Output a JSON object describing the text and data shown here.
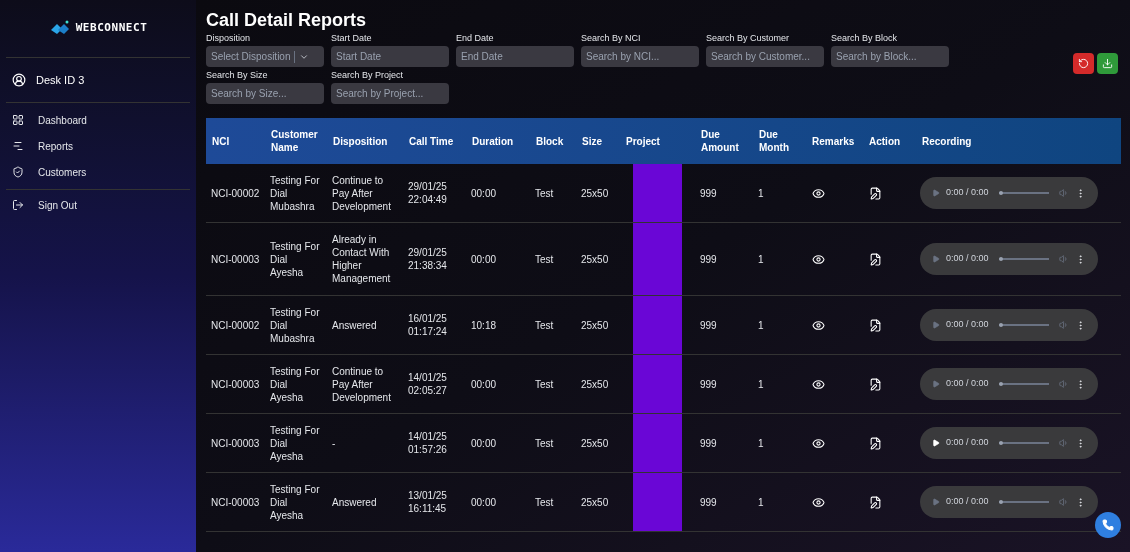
{
  "sidebar": {
    "logo": "WEBCONNECT",
    "user": "Desk ID 3",
    "items": [
      {
        "label": "Dashboard"
      },
      {
        "label": "Reports"
      },
      {
        "label": "Customers"
      }
    ],
    "sign_out": "Sign Out"
  },
  "title": "Call Detail Reports",
  "filters": [
    {
      "label": "Disposition",
      "placeholder": "Select Disposition",
      "kind": "select"
    },
    {
      "label": "Start Date",
      "placeholder": "Start Date",
      "kind": "input"
    },
    {
      "label": "End Date",
      "placeholder": "End Date",
      "kind": "input"
    },
    {
      "label": "Search By NCI",
      "placeholder": "Search by NCI...",
      "kind": "input"
    },
    {
      "label": "Search By Customer",
      "placeholder": "Search by Customer...",
      "kind": "input"
    },
    {
      "label": "Search By Block",
      "placeholder": "Search by Block...",
      "kind": "input"
    },
    {
      "label": "Search By Size",
      "placeholder": "Search by Size...",
      "kind": "input"
    },
    {
      "label": "Search By Project",
      "placeholder": "Search by Project...",
      "kind": "input"
    }
  ],
  "table": {
    "columns": [
      "NCI",
      "Customer Name",
      "Disposition",
      "Call Time",
      "Duration",
      "Block",
      "Size",
      "Project",
      "Due Amount",
      "Due Month",
      "Remarks",
      "Action",
      "Recording"
    ],
    "rows": [
      {
        "nci": "NCI-00002",
        "customer": "Testing For Dial Mubashra",
        "disposition": "Continue to Pay After Development",
        "call_time": "29/01/25 22:04:49",
        "duration": "00:00",
        "block": "Test",
        "size": "25x50",
        "due_amount": "999",
        "due_month": "1",
        "recording": "0:00 / 0:00",
        "playable": false,
        "level": 0
      },
      {
        "nci": "NCI-00003",
        "customer": "Testing For Dial Ayesha",
        "disposition": "Already in Contact With Higher Management",
        "call_time": "29/01/25 21:38:34",
        "duration": "00:00",
        "block": "Test",
        "size": "25x50",
        "due_amount": "999",
        "due_month": "1",
        "recording": "0:00 / 0:00",
        "playable": false,
        "level": 0
      },
      {
        "nci": "NCI-00002",
        "customer": "Testing For Dial Mubashra",
        "disposition": "Answered",
        "call_time": "16/01/25 01:17:24",
        "duration": "10:18",
        "block": "Test",
        "size": "25x50",
        "due_amount": "999",
        "due_month": "1",
        "recording": "0:00 / 0:00",
        "playable": false,
        "level": 0
      },
      {
        "nci": "NCI-00003",
        "customer": "Testing For Dial Ayesha",
        "disposition": "Continue to Pay After Development",
        "call_time": "14/01/25 02:05:27",
        "duration": "00:00",
        "block": "Test",
        "size": "25x50",
        "due_amount": "999",
        "due_month": "1",
        "recording": "0:00 / 0:00",
        "playable": false,
        "level": 0
      },
      {
        "nci": "NCI-00003",
        "customer": "Testing For Dial Ayesha",
        "disposition": "-",
        "call_time": "14/01/25 01:57:26",
        "duration": "00:00",
        "block": "Test",
        "size": "25x50",
        "due_amount": "999",
        "due_month": "1",
        "recording": "0:00 / 0:00",
        "playable": true,
        "level": 0
      },
      {
        "nci": "NCI-00003",
        "customer": "Testing For Dial Ayesha",
        "disposition": "Answered",
        "call_time": "13/01/25 16:11:45",
        "duration": "00:00",
        "block": "Test",
        "size": "25x50",
        "due_amount": "999",
        "due_month": "1",
        "recording": "0:00 / 0:00",
        "playable": false,
        "level": 0
      }
    ]
  }
}
